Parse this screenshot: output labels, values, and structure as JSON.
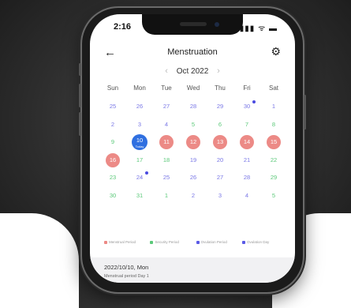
{
  "status_bar": {
    "time": "2:16",
    "indicators": "▮▮▮ ᯤ ▬"
  },
  "header": {
    "back_icon": "←",
    "title": "Menstruation",
    "settings_icon": "⚙"
  },
  "month_nav": {
    "prev_icon": "‹",
    "label": "Oct 2022",
    "next_icon": "›"
  },
  "weekdays": [
    "Sun",
    "Mon",
    "Tue",
    "Wed",
    "Thu",
    "Fri",
    "Sat"
  ],
  "calendar": {
    "today_label": "Today",
    "weeks": [
      [
        {
          "d": "25",
          "c": "blue"
        },
        {
          "d": "26",
          "c": "blue"
        },
        {
          "d": "27",
          "c": "blue"
        },
        {
          "d": "28",
          "c": "blue"
        },
        {
          "d": "29",
          "c": "blue"
        },
        {
          "d": "30",
          "c": "blue",
          "ovu": true
        },
        {
          "d": "1",
          "c": "blue"
        }
      ],
      [
        {
          "d": "2",
          "c": "blue"
        },
        {
          "d": "3",
          "c": "blue"
        },
        {
          "d": "4",
          "c": "blue"
        },
        {
          "d": "5",
          "c": "green"
        },
        {
          "d": "6",
          "c": "green"
        },
        {
          "d": "7",
          "c": "green"
        },
        {
          "d": "8",
          "c": "green"
        }
      ],
      [
        {
          "d": "9",
          "c": "green"
        },
        {
          "d": "10",
          "s": "today"
        },
        {
          "d": "11",
          "s": "period"
        },
        {
          "d": "12",
          "s": "period"
        },
        {
          "d": "13",
          "s": "period"
        },
        {
          "d": "14",
          "s": "period"
        },
        {
          "d": "15",
          "s": "period"
        }
      ],
      [
        {
          "d": "16",
          "s": "period"
        },
        {
          "d": "17",
          "c": "green"
        },
        {
          "d": "18",
          "c": "green"
        },
        {
          "d": "19",
          "c": "blue"
        },
        {
          "d": "20",
          "c": "blue"
        },
        {
          "d": "21",
          "c": "blue"
        },
        {
          "d": "22",
          "c": "green"
        }
      ],
      [
        {
          "d": "23",
          "c": "green"
        },
        {
          "d": "24",
          "c": "blue",
          "ovu": true
        },
        {
          "d": "25",
          "c": "blue"
        },
        {
          "d": "26",
          "c": "blue"
        },
        {
          "d": "27",
          "c": "blue"
        },
        {
          "d": "28",
          "c": "blue"
        },
        {
          "d": "29",
          "c": "green"
        }
      ],
      [
        {
          "d": "30",
          "c": "green"
        },
        {
          "d": "31",
          "c": "green"
        },
        {
          "d": "1",
          "c": "green"
        },
        {
          "d": "2",
          "c": "blue"
        },
        {
          "d": "3",
          "c": "blue"
        },
        {
          "d": "4",
          "c": "blue"
        },
        {
          "d": "5",
          "c": "green"
        }
      ]
    ]
  },
  "legend": [
    {
      "label": "Menstrual Period",
      "color": "#ec8a86"
    },
    {
      "label": "Security Period",
      "color": "#5cc97a"
    },
    {
      "label": "Ovulation Period",
      "color": "#5a5ae6"
    },
    {
      "label": "Ovulation Day",
      "color": "#5a5ae6"
    }
  ],
  "info": {
    "date": "2022/10/10, Mon",
    "detail": "Menstrual period Day 1"
  },
  "colors": {
    "blue_text": "#7a78e6",
    "green_text": "#5cc97a",
    "period_fill": "#ec8a86",
    "today_fill": "#2f6fe0"
  }
}
